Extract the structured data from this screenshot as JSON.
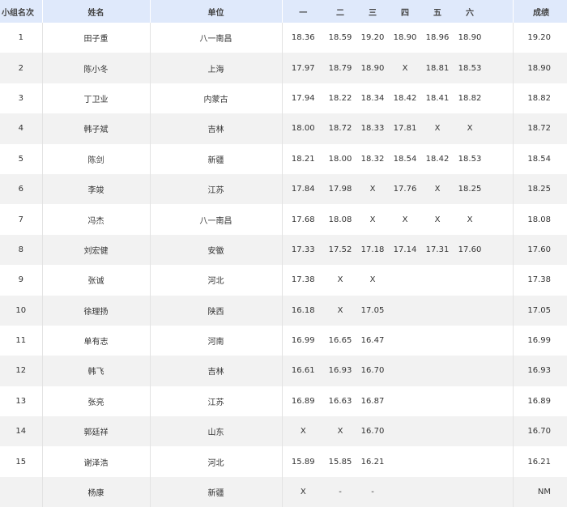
{
  "headers": [
    "小组名次",
    "姓名",
    "单位",
    "一",
    "二",
    "三",
    "四",
    "五",
    "六",
    "",
    "成绩"
  ],
  "rows": [
    {
      "rank": "1",
      "name": "田子重",
      "unit": "八一南昌",
      "a": [
        "18.36",
        "18.59",
        "19.20",
        "18.90",
        "18.96",
        "18.90"
      ],
      "result": "19.20"
    },
    {
      "rank": "2",
      "name": "陈小冬",
      "unit": "上海",
      "a": [
        "17.97",
        "18.79",
        "18.90",
        "X",
        "18.81",
        "18.53"
      ],
      "result": "18.90"
    },
    {
      "rank": "3",
      "name": "丁卫业",
      "unit": "内蒙古",
      "a": [
        "17.94",
        "18.22",
        "18.34",
        "18.42",
        "18.41",
        "18.82"
      ],
      "result": "18.82"
    },
    {
      "rank": "4",
      "name": "韩子斌",
      "unit": "吉林",
      "a": [
        "18.00",
        "18.72",
        "18.33",
        "17.81",
        "X",
        "X"
      ],
      "result": "18.72"
    },
    {
      "rank": "5",
      "name": "陈剑",
      "unit": "新疆",
      "a": [
        "18.21",
        "18.00",
        "18.32",
        "18.54",
        "18.42",
        "18.53"
      ],
      "result": "18.54"
    },
    {
      "rank": "6",
      "name": "李竣",
      "unit": "江苏",
      "a": [
        "17.84",
        "17.98",
        "X",
        "17.76",
        "X",
        "18.25"
      ],
      "result": "18.25"
    },
    {
      "rank": "7",
      "name": "冯杰",
      "unit": "八一南昌",
      "a": [
        "17.68",
        "18.08",
        "X",
        "X",
        "X",
        "X"
      ],
      "result": "18.08"
    },
    {
      "rank": "8",
      "name": "刘宏健",
      "unit": "安徽",
      "a": [
        "17.33",
        "17.52",
        "17.18",
        "17.14",
        "17.31",
        "17.60"
      ],
      "result": "17.60"
    },
    {
      "rank": "9",
      "name": "张诚",
      "unit": "河北",
      "a": [
        "17.38",
        "X",
        "X",
        "",
        "",
        ""
      ],
      "result": "17.38"
    },
    {
      "rank": "10",
      "name": "徐理扬",
      "unit": "陕西",
      "a": [
        "16.18",
        "X",
        "17.05",
        "",
        "",
        ""
      ],
      "result": "17.05"
    },
    {
      "rank": "11",
      "name": "单有志",
      "unit": "河南",
      "a": [
        "16.99",
        "16.65",
        "16.47",
        "",
        "",
        ""
      ],
      "result": "16.99"
    },
    {
      "rank": "12",
      "name": "韩飞",
      "unit": "吉林",
      "a": [
        "16.61",
        "16.93",
        "16.70",
        "",
        "",
        ""
      ],
      "result": "16.93"
    },
    {
      "rank": "13",
      "name": "张亮",
      "unit": "江苏",
      "a": [
        "16.89",
        "16.63",
        "16.87",
        "",
        "",
        ""
      ],
      "result": "16.89"
    },
    {
      "rank": "14",
      "name": "郭廷祥",
      "unit": "山东",
      "a": [
        "X",
        "X",
        "16.70",
        "",
        "",
        ""
      ],
      "result": "16.70"
    },
    {
      "rank": "15",
      "name": "谢泽浩",
      "unit": "河北",
      "a": [
        "15.89",
        "15.85",
        "16.21",
        "",
        "",
        ""
      ],
      "result": "16.21"
    },
    {
      "rank": "",
      "name": "杨康",
      "unit": "新疆",
      "a": [
        "X",
        "-",
        "-",
        "",
        "",
        ""
      ],
      "result": "NM"
    }
  ]
}
